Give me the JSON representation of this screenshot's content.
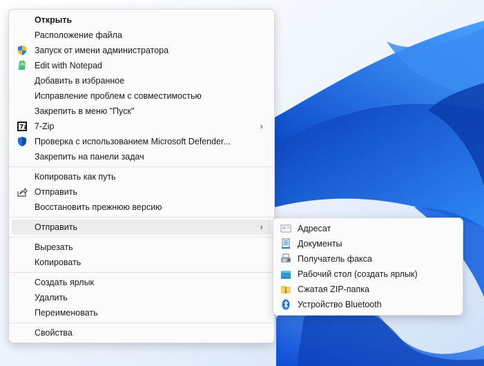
{
  "context_menu": {
    "items": [
      {
        "label": "Открыть"
      },
      {
        "label": "Расположение файла"
      },
      {
        "label": "Запуск от имени администратора",
        "icon": "uac-shield-icon"
      },
      {
        "label": "Edit with Notepad",
        "icon": "notepad-icon"
      },
      {
        "label": "Добавить в избранное"
      },
      {
        "label": "Исправление проблем с совместимостью"
      },
      {
        "label": "Закрепить в меню \"Пуск\""
      },
      {
        "label": "7-Zip",
        "icon": "7zip-icon"
      },
      {
        "label": "Проверка с использованием Microsoft Defender...",
        "icon": "defender-icon"
      },
      {
        "label": "Закрепить на панели задач"
      },
      {
        "label": "Копировать как путь"
      },
      {
        "label": "Отправить",
        "icon": "share-icon"
      },
      {
        "label": "Восстановить прежнюю версию"
      },
      {
        "label": "Отправить"
      },
      {
        "label": "Вырезать"
      },
      {
        "label": "Копировать"
      },
      {
        "label": "Создать ярлык"
      },
      {
        "label": "Удалить"
      },
      {
        "label": "Переименовать"
      },
      {
        "label": "Свойства"
      }
    ],
    "submenu_glyph": "›"
  },
  "send_to_submenu": {
    "items": [
      {
        "label": "Адресат",
        "icon": "mail-recipient-icon"
      },
      {
        "label": "Документы",
        "icon": "documents-icon"
      },
      {
        "label": "Получатель факса",
        "icon": "fax-icon"
      },
      {
        "label": "Рабочий стол (создать ярлык)",
        "icon": "desktop-icon"
      },
      {
        "label": "Сжатая ZIP-папка",
        "icon": "zip-folder-icon"
      },
      {
        "label": "Устройство Bluetooth",
        "icon": "bluetooth-icon"
      }
    ]
  },
  "colors": {
    "menu_bg": "#fbfbfb",
    "hover_bg": "#ececec",
    "wallpaper_blue": "#1e6fe8"
  }
}
